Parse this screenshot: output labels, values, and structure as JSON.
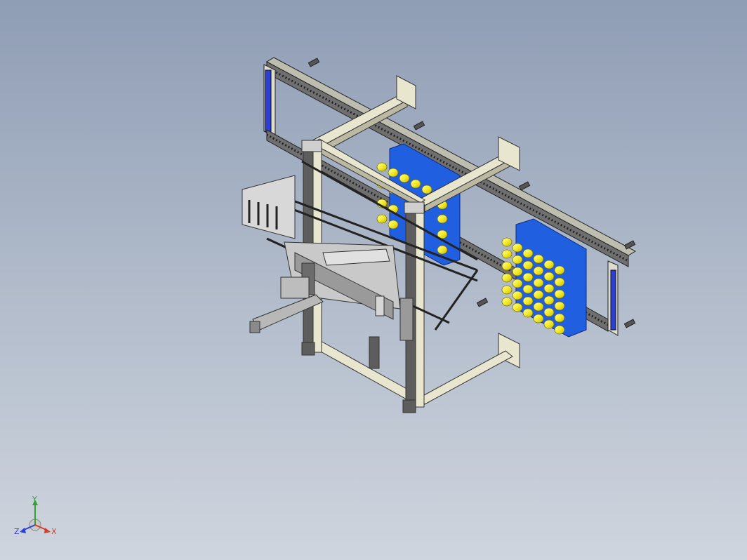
{
  "viewport": {
    "background_top": "#8f9db5",
    "background_bottom": "#cfd5de",
    "model": {
      "frame_color": "#e9e6cf",
      "rail_color": "#6f6f6f",
      "tray_color": "#1f5fe0",
      "spool_color": "#f2ec2a",
      "carriage_color": "#c9c9c9"
    }
  },
  "triad": {
    "y_label": "Y",
    "z_label": "Z",
    "x_label": "X",
    "y_color": "#2fa52f",
    "z_color": "#2b3fd6",
    "x_color": "#d63b2b"
  }
}
